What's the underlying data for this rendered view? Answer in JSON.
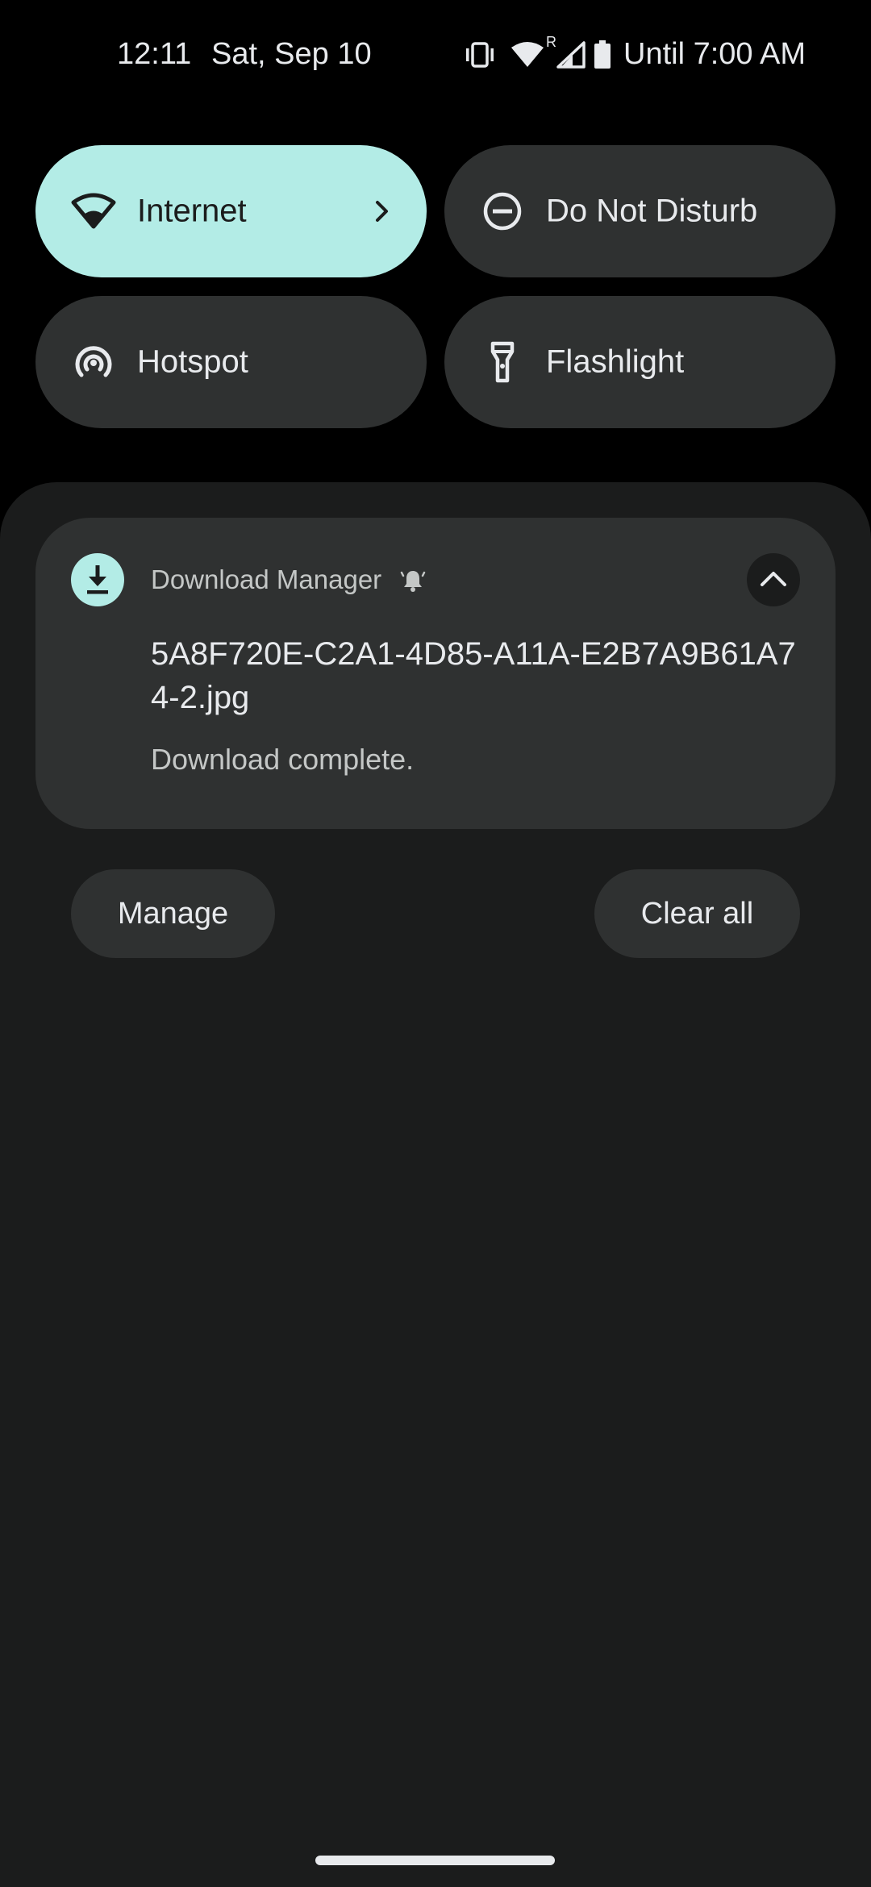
{
  "status_bar": {
    "time": "12:11",
    "date": "Sat, Sep 10",
    "alarm_text": "Until 7:00 AM",
    "icons": [
      "vibrate-icon",
      "wifi-icon",
      "signal-icon",
      "battery-icon"
    ],
    "roaming_indicator": "R"
  },
  "quick_settings": {
    "tiles": [
      {
        "label": "Internet",
        "icon": "wifi-icon",
        "active": true,
        "has_chevron": true
      },
      {
        "label": "Do Not Disturb",
        "icon": "do-not-disturb-icon",
        "active": false
      },
      {
        "label": "Hotspot",
        "icon": "hotspot-icon",
        "active": false
      },
      {
        "label": "Flashlight",
        "icon": "flashlight-icon",
        "active": false
      }
    ]
  },
  "notification": {
    "app_name": "Download Manager",
    "app_icon": "download-icon",
    "title": "5A8F720E-C2A1-4D85-A11A-E2B7A9B61A74-2.jpg",
    "text": "Download complete."
  },
  "footer": {
    "manage_label": "Manage",
    "clear_all_label": "Clear all"
  },
  "colors": {
    "accent": "#b3ece6",
    "surface": "#2f3131",
    "shade": "#1b1c1c",
    "background": "#000000"
  }
}
